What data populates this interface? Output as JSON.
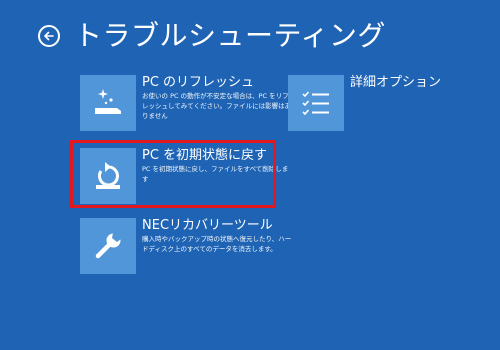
{
  "header": {
    "back_icon": "back-arrow-icon",
    "title": "トラブルシューティング"
  },
  "options": {
    "refresh": {
      "icon": "sparkle-icon",
      "label": "PC のリフレッシュ",
      "description": "お使いの PC の動作が不安定な場合は、PC をリフレッシュしてみてください。ファイルには影響はありません"
    },
    "reset": {
      "icon": "reset-arrow-icon",
      "label": "PC を初期状態に戻す",
      "description": "PC を初期状態に戻し、ファイルをすべて削除します",
      "highlighted": true
    },
    "nec": {
      "icon": "wrench-icon",
      "label": "NECリカバリーツール",
      "description": "購入時やバックアップ時の状態へ復元したり、ハードディスク上のすべてのデータを消去します。"
    },
    "advanced": {
      "icon": "checklist-icon",
      "label": "詳細オプション"
    }
  },
  "colors": {
    "background": "#1f64b4",
    "tile": "#5096d8",
    "highlight": "#e3171f"
  }
}
